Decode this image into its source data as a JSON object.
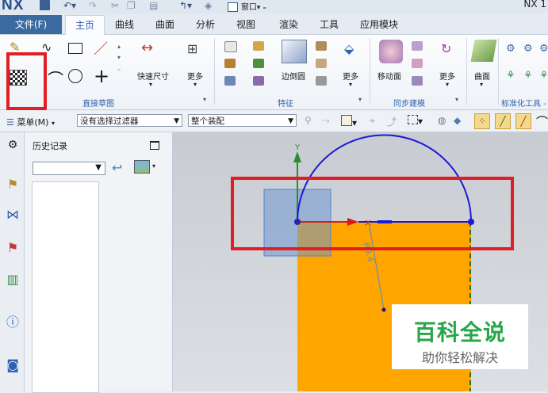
{
  "titlebar": {
    "logo": "NX",
    "window_menu": "窗口",
    "app_title": "NX 1"
  },
  "tabs": {
    "file": "文件(F)",
    "items": [
      "主页",
      "曲线",
      "曲面",
      "分析",
      "视图",
      "渲染",
      "工具",
      "应用模块"
    ],
    "active": "主页"
  },
  "ribbon": {
    "quick_dim": "快速尺寸",
    "more": "更多",
    "edge_blend": "边倒圆",
    "move_face": "移动面",
    "surface": "曲面",
    "groups": {
      "sketch": "直接草图",
      "feature": "特征",
      "sync": "同步建模",
      "std_parts": "标准化工具 -"
    }
  },
  "cmdbar": {
    "menu": "菜单(M)",
    "filter": "没有选择过滤器",
    "assembly": "整个装配"
  },
  "history": {
    "title": "历史记录",
    "dropdown_value": ""
  },
  "graphics": {
    "y_axis": "Y",
    "dim_label": "R9.4"
  },
  "watermark": {
    "title": "百科全说",
    "subtitle": "助你轻松解决"
  },
  "colors": {
    "accent": "#2f62b0",
    "highlight": "#e01e24",
    "solid": "#ffa500",
    "arc": "#1a1ad6",
    "wm_green": "#28a64a"
  }
}
